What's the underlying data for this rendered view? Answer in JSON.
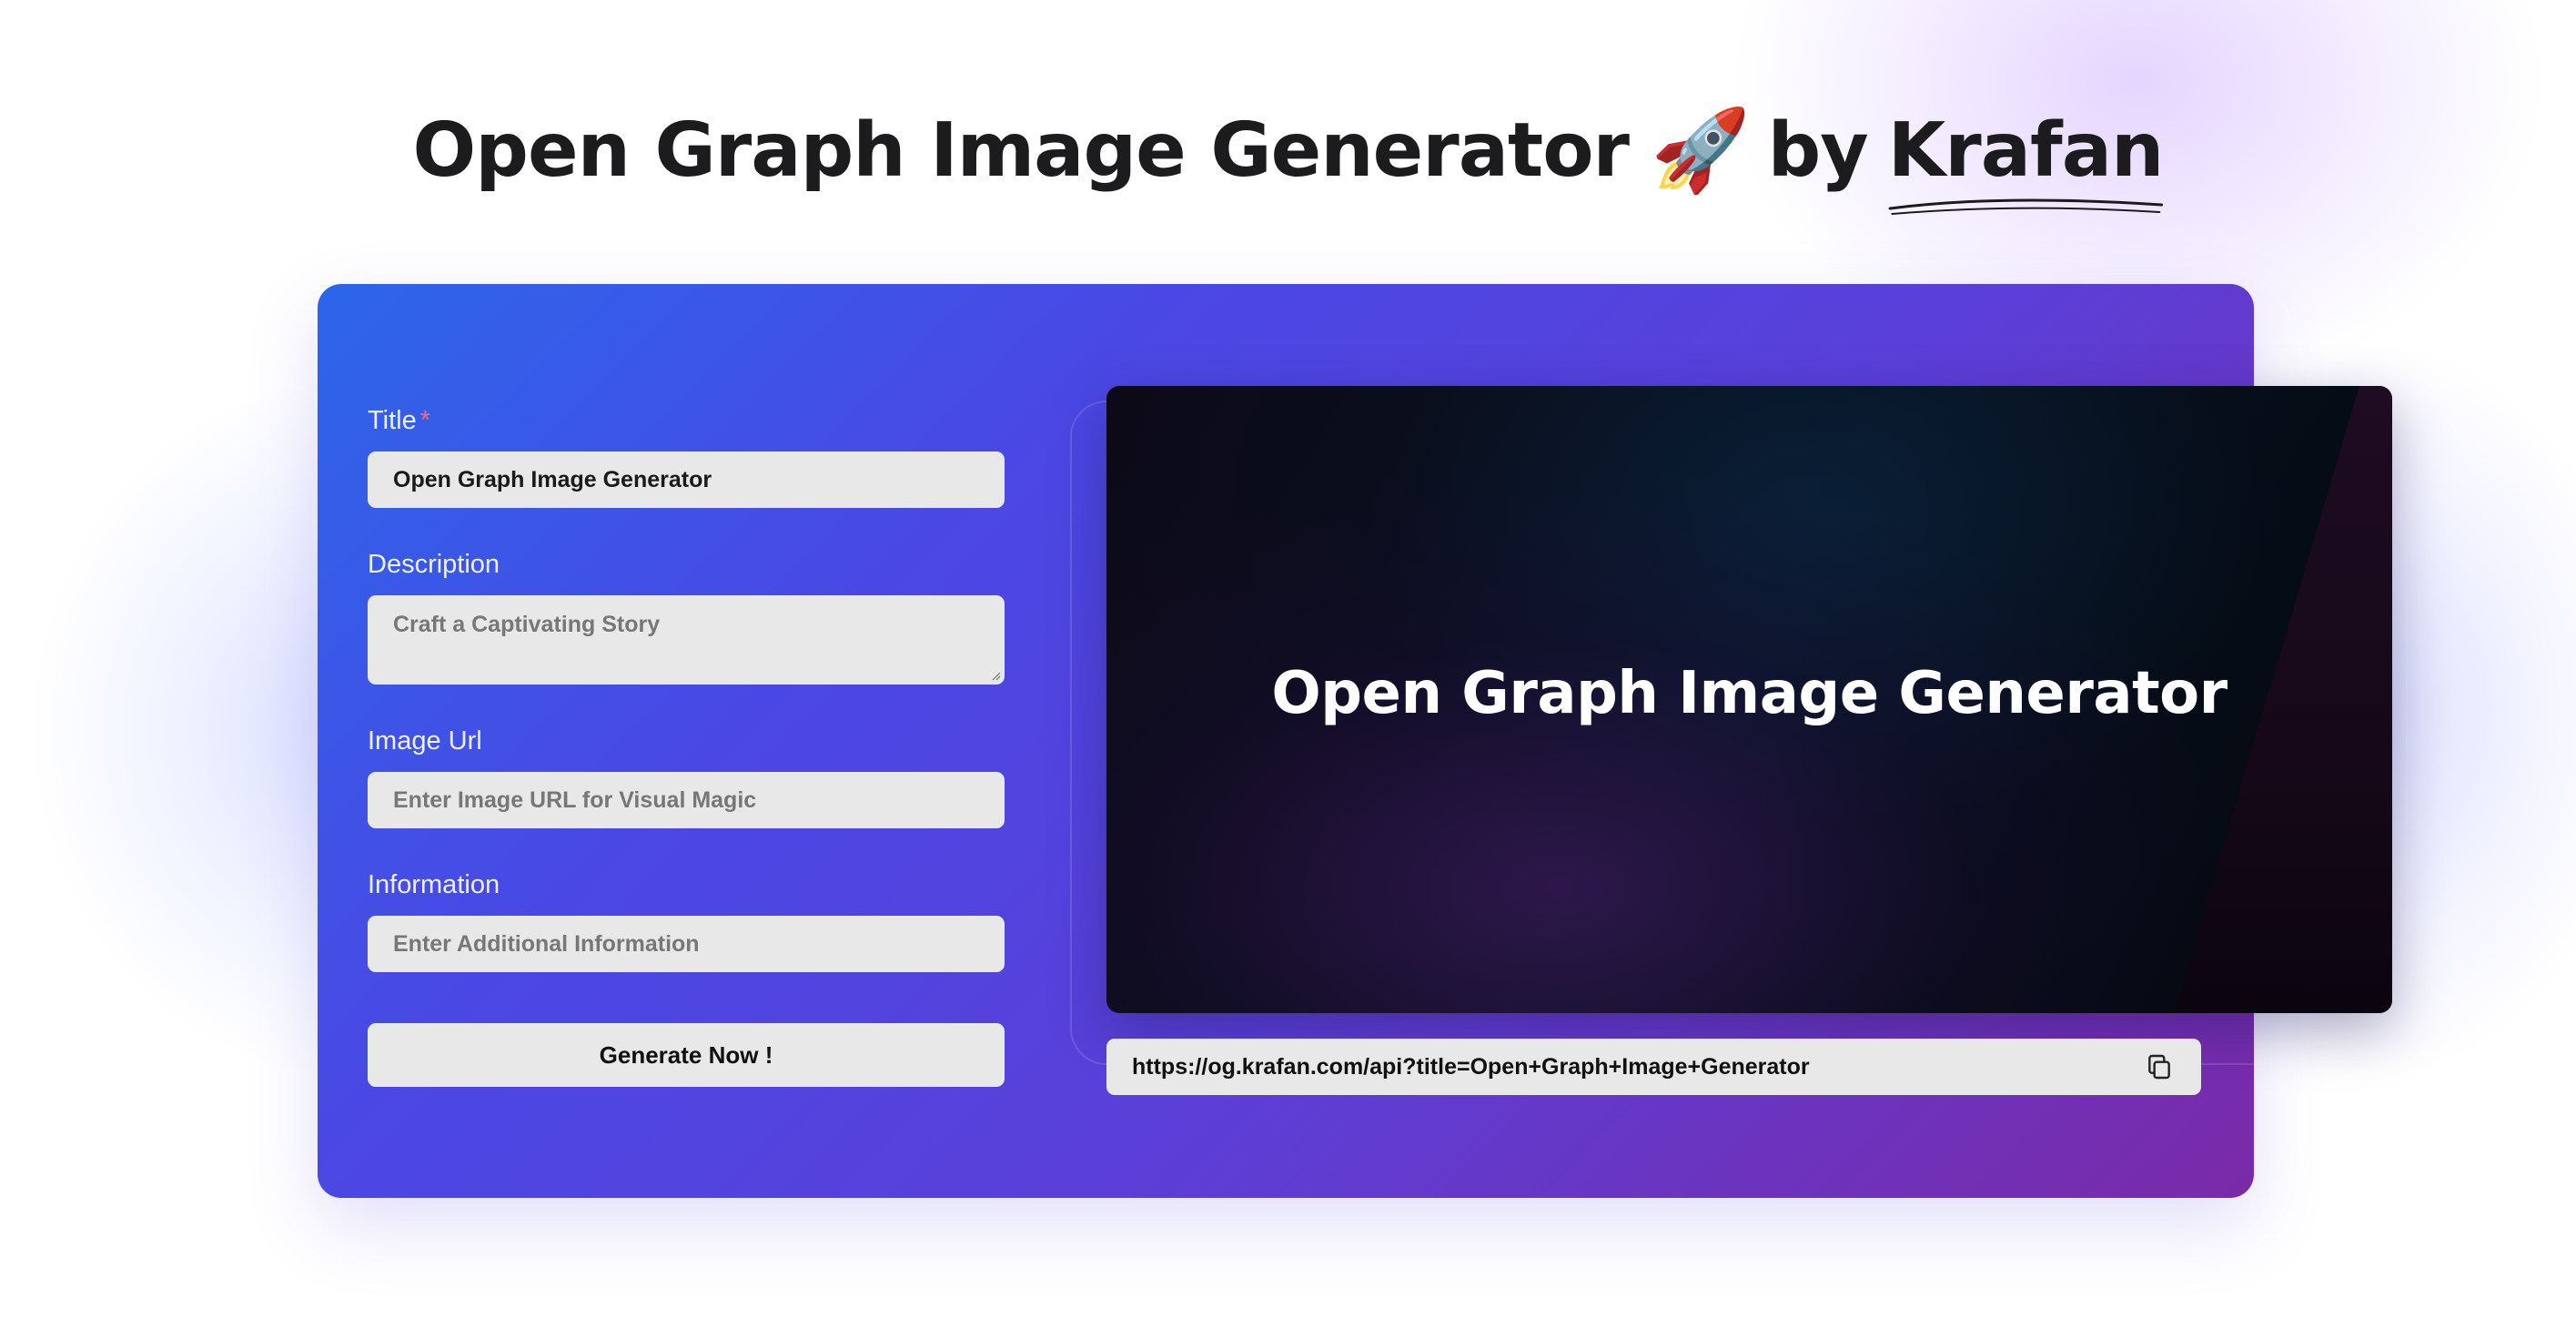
{
  "header": {
    "title": "Open Graph Image Generator",
    "emoji": "🚀",
    "by": "by",
    "brand": "Krafan"
  },
  "form": {
    "title_label": "Title",
    "title_required_mark": "*",
    "title_value": "Open Graph Image Generator",
    "description_label": "Description",
    "description_placeholder": "Craft a Captivating Story",
    "image_url_label": "Image Url",
    "image_url_placeholder": "Enter Image URL for Visual Magic",
    "information_label": "Information",
    "information_placeholder": "Enter Additional Information",
    "generate_button": "Generate Now !"
  },
  "preview": {
    "title": "Open Graph Image Generator"
  },
  "url_bar": {
    "url": "https://og.krafan.com/api?title=Open+Graph+Image+Generator",
    "copy_icon": "copy-icon"
  },
  "colors": {
    "card_gradient_start": "#2c66ea",
    "card_gradient_end": "#7a2aa8",
    "input_background": "#e8e8e8",
    "required_mark": "#ff6b6b"
  }
}
